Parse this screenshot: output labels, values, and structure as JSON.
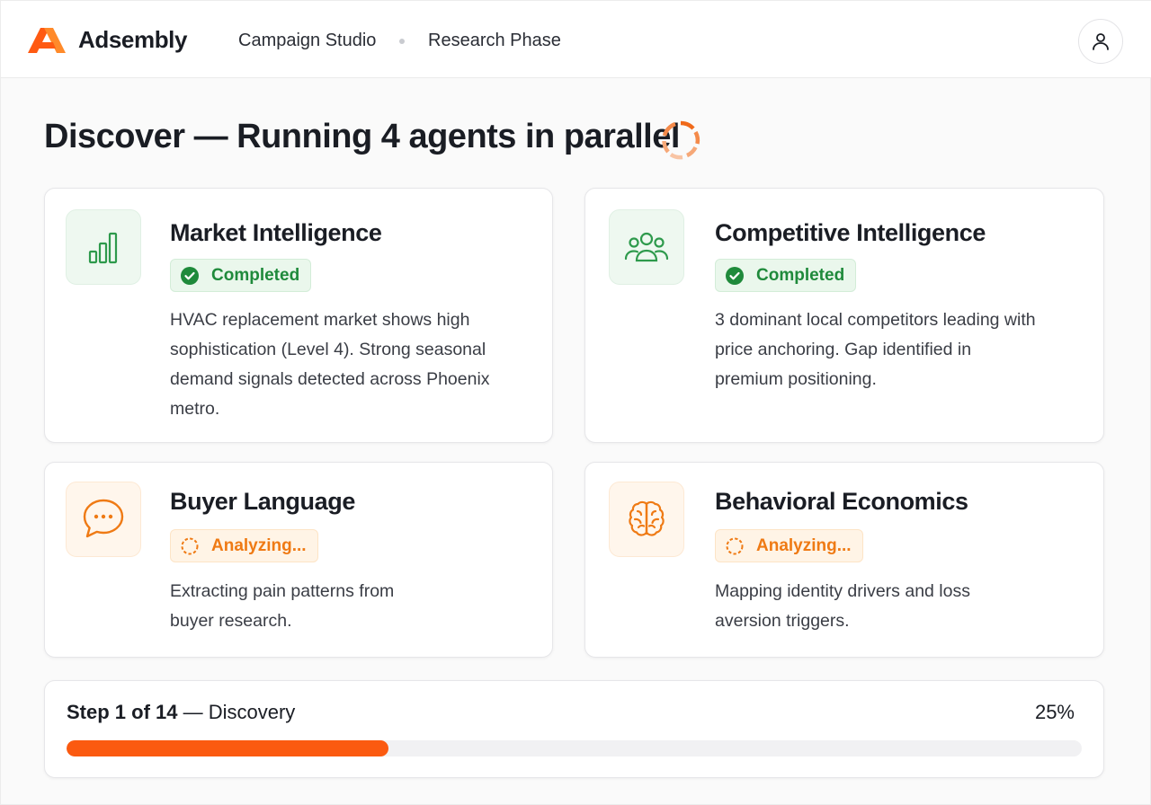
{
  "header": {
    "brand": "Adsembly",
    "breadcrumb": [
      "Campaign Studio",
      "Research Phase"
    ],
    "brand_colors": [
      "#ff5a12",
      "#ff9a3c"
    ]
  },
  "page": {
    "title": "Discover — Running 4 agents in parallel",
    "status_icon": "loading-spinner-icon"
  },
  "agents": [
    {
      "title": "Market Intelligence",
      "icon": "bar-chart-icon",
      "status": "Completed",
      "status_type": "completed",
      "description": "HVAC replacement market shows high sophistication (Level 4). Strong seasonal demand signals detected across Phoenix metro."
    },
    {
      "title": "Competitive Intelligence",
      "icon": "users-icon",
      "status": "Completed",
      "status_type": "completed",
      "description": "3 dominant local competitors leading with price anchoring. Gap identified in premium positioning."
    },
    {
      "title": "Buyer Language",
      "icon": "chat-bubble-icon",
      "status": "Analyzing...",
      "status_type": "analyzing",
      "description": "Extracting pain patterns from buyer research."
    },
    {
      "title": "Behavioral Economics",
      "icon": "brain-icon",
      "status": "Analyzing...",
      "status_type": "analyzing",
      "description": "Mapping identity drivers and loss aversion triggers."
    }
  ],
  "progress": {
    "step_strong": "Step 1 of 14",
    "step_rest": " — Discovery",
    "percent_label": "25%",
    "value": 0.317
  },
  "colors": {
    "accent": "#fb5a10",
    "completed": "#1f8a3b",
    "analyzing": "#ef7a14"
  }
}
